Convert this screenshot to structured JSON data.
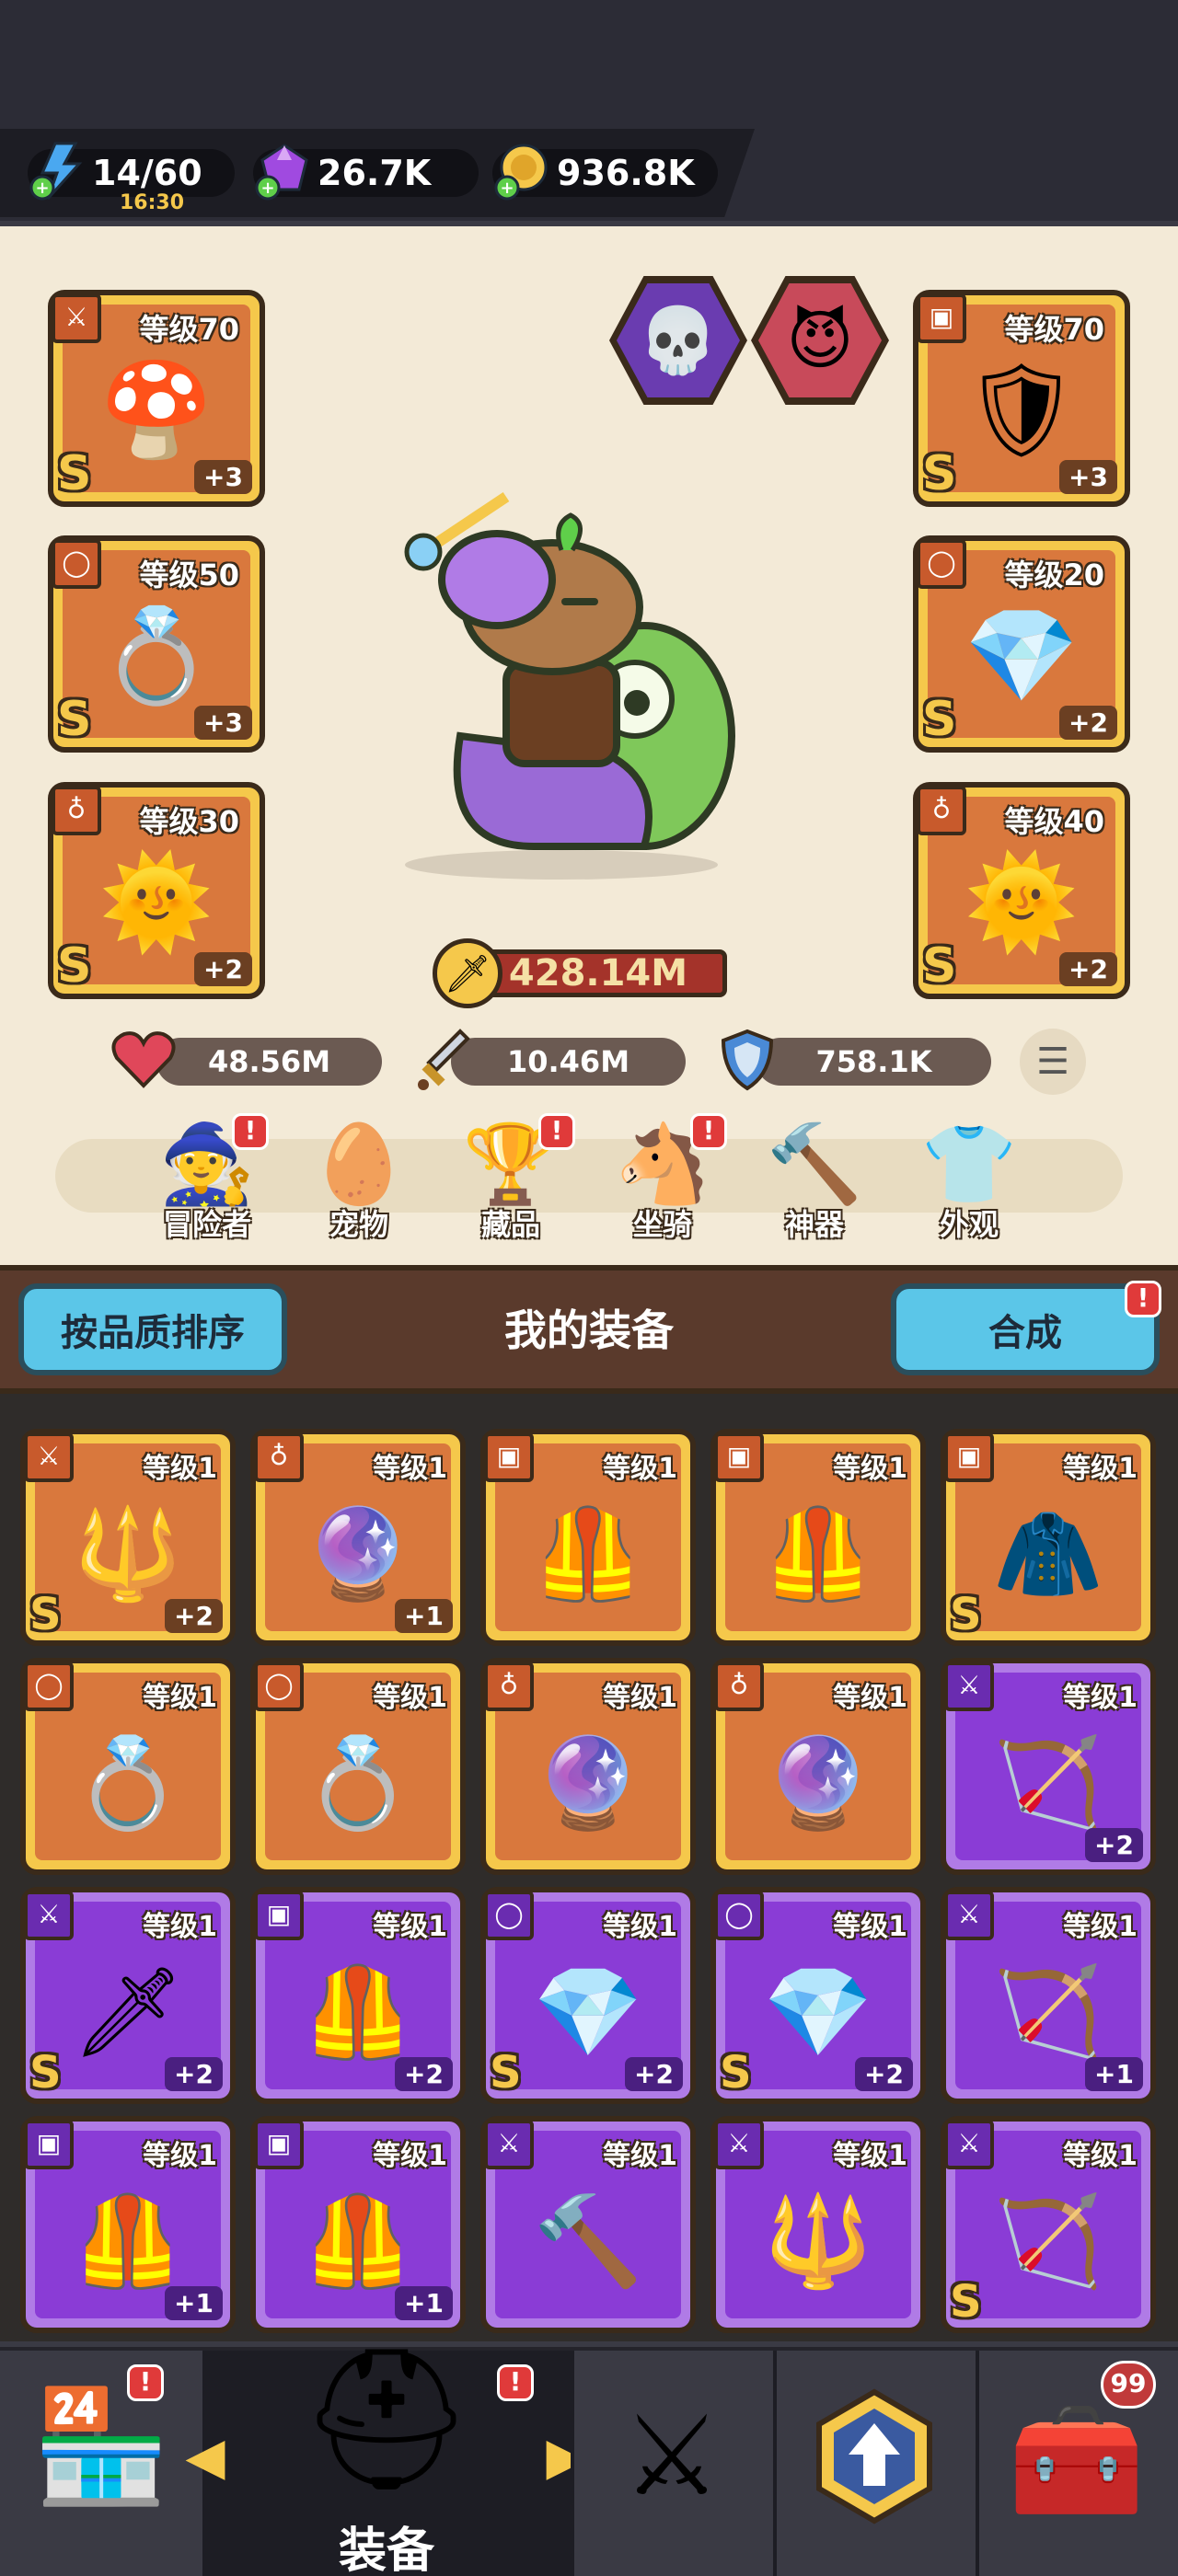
{
  "resources": {
    "energy": {
      "value": "14/60",
      "timer": "16:30",
      "icon": "lightning-icon"
    },
    "gems": {
      "value": "26.7K",
      "icon": "gem-icon"
    },
    "gold": {
      "value": "936.8K",
      "icon": "coin-icon"
    }
  },
  "equipped": {
    "left": [
      {
        "level": "等级70",
        "grade": "S",
        "plus": "+3",
        "type_icon": "sword-icon",
        "art": "purple-mushroom-staff"
      },
      {
        "level": "等级50",
        "grade": "S",
        "plus": "+3",
        "type_icon": "ring-icon",
        "art": "ornate-ring"
      },
      {
        "level": "等级30",
        "grade": "S",
        "plus": "+2",
        "type_icon": "necklace-icon",
        "art": "sun-amulet"
      }
    ],
    "right": [
      {
        "level": "等级70",
        "grade": "S",
        "plus": "+3",
        "type_icon": "armor-icon",
        "art": "dark-armor"
      },
      {
        "level": "等级20",
        "grade": "S",
        "plus": "+2",
        "type_icon": "ring-icon",
        "art": "crystal-ring"
      },
      {
        "level": "等级40",
        "grade": "S",
        "plus": "+2",
        "type_icon": "necklace-icon",
        "art": "sun-amulet"
      }
    ]
  },
  "power": "428.14M",
  "stats": {
    "hp": "48.56M",
    "attack": "10.46M",
    "defense": "758.1K"
  },
  "subnav": [
    {
      "label": "冒险者",
      "icon": "adventurer-icon",
      "alert": "!"
    },
    {
      "label": "宠物",
      "icon": "pet-egg-icon",
      "alert": ""
    },
    {
      "label": "藏品",
      "icon": "collection-icon",
      "alert": "!"
    },
    {
      "label": "坐骑",
      "icon": "mount-icon",
      "alert": "!"
    },
    {
      "label": "神器",
      "icon": "artifact-hammer-icon",
      "alert": ""
    },
    {
      "label": "外观",
      "icon": "outfit-icon",
      "alert": ""
    }
  ],
  "section": {
    "sort_label": "按品质排序",
    "title": "我的装备",
    "merge_label": "合成",
    "merge_alert": "!"
  },
  "inventory": [
    {
      "level": "等级1",
      "grade": "S",
      "plus": "+2",
      "rarity": "orange",
      "type_icon": "sword-icon",
      "art": "golden-mace"
    },
    {
      "level": "等级1",
      "grade": "",
      "plus": "+1",
      "rarity": "orange",
      "type_icon": "necklace-icon",
      "art": "blue-orb"
    },
    {
      "level": "等级1",
      "grade": "",
      "plus": "",
      "rarity": "orange",
      "type_icon": "armor-icon",
      "art": "leather-vest"
    },
    {
      "level": "等级1",
      "grade": "",
      "plus": "",
      "rarity": "orange",
      "type_icon": "armor-icon",
      "art": "leather-vest"
    },
    {
      "level": "等级1",
      "grade": "S",
      "plus": "",
      "rarity": "orange",
      "type_icon": "armor-icon",
      "art": "purple-cloak"
    },
    {
      "level": "等级1",
      "grade": "",
      "plus": "",
      "rarity": "orange",
      "type_icon": "ring-icon",
      "art": "gold-ring"
    },
    {
      "level": "等级1",
      "grade": "",
      "plus": "",
      "rarity": "orange",
      "type_icon": "ring-icon",
      "art": "gold-ring"
    },
    {
      "level": "等级1",
      "grade": "",
      "plus": "",
      "rarity": "orange",
      "type_icon": "necklace-icon",
      "art": "blue-orb"
    },
    {
      "level": "等级1",
      "grade": "",
      "plus": "",
      "rarity": "orange",
      "type_icon": "necklace-icon",
      "art": "blue-orb"
    },
    {
      "level": "等级1",
      "grade": "",
      "plus": "+2",
      "rarity": "purple",
      "type_icon": "sword-icon",
      "art": "crossbow"
    },
    {
      "level": "等级1",
      "grade": "S",
      "plus": "+2",
      "rarity": "purple",
      "type_icon": "sword-icon",
      "art": "dark-sword"
    },
    {
      "level": "等级1",
      "grade": "",
      "plus": "+2",
      "rarity": "purple",
      "type_icon": "armor-icon",
      "art": "leather-vest"
    },
    {
      "level": "等级1",
      "grade": "S",
      "plus": "+2",
      "rarity": "purple",
      "type_icon": "ring-icon",
      "art": "crystal-ring"
    },
    {
      "level": "等级1",
      "grade": "S",
      "plus": "+2",
      "rarity": "purple",
      "type_icon": "ring-icon",
      "art": "crystal-ring"
    },
    {
      "level": "等级1",
      "grade": "",
      "plus": "+1",
      "rarity": "purple",
      "type_icon": "sword-icon",
      "art": "bone-crossbow"
    },
    {
      "level": "等级1",
      "grade": "",
      "plus": "+1",
      "rarity": "purple",
      "type_icon": "armor-icon",
      "art": "leather-vest"
    },
    {
      "level": "等级1",
      "grade": "",
      "plus": "+1",
      "rarity": "purple",
      "type_icon": "armor-icon",
      "art": "leather-vest"
    },
    {
      "level": "等级1",
      "grade": "",
      "plus": "",
      "rarity": "purple",
      "type_icon": "sword-icon",
      "art": "stone-hammer"
    },
    {
      "level": "等级1",
      "grade": "",
      "plus": "",
      "rarity": "purple",
      "type_icon": "sword-icon",
      "art": "ice-spear"
    },
    {
      "level": "等级1",
      "grade": "S",
      "plus": "",
      "rarity": "purple",
      "type_icon": "sword-icon",
      "art": "green-crossbow"
    }
  ],
  "bottom_nav": [
    {
      "icon": "shop-icon",
      "alert": "!"
    },
    {
      "icon": "helmet-icon",
      "label": "装备",
      "alert": "!"
    },
    {
      "icon": "crossed-swords-icon"
    },
    {
      "icon": "upgrade-arrow-icon"
    },
    {
      "icon": "treasure-chest-icon",
      "count": "99"
    }
  ],
  "colors": {
    "orange_frame": "#f5c84b",
    "orange_fill": "#d9783d",
    "purple_frame": "#b07be6",
    "purple_fill": "#8a3cd6",
    "accent_blue": "#5bc6e8",
    "alert_red": "#e03a3a"
  }
}
